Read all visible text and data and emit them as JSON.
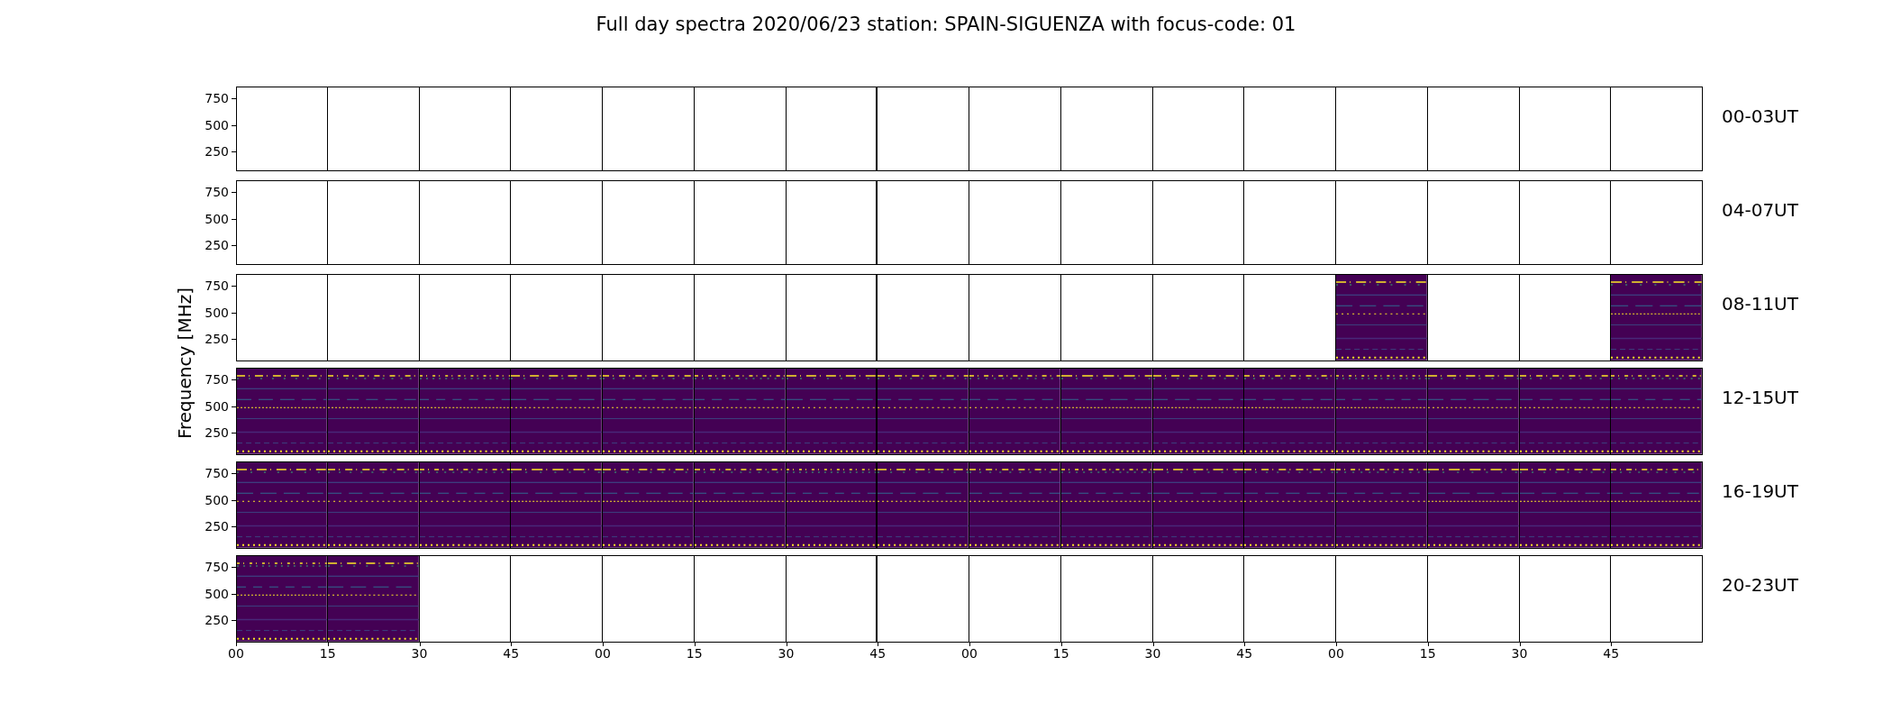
{
  "title": "Full day spectra 2020/06/23 station: SPAIN-SIGUENZA with focus-code: 01",
  "ylabel": "Frequency [MHz]",
  "rows": [
    {
      "label": "00-03UT",
      "yticks": [
        "750",
        "500",
        "250"
      ],
      "cells": [
        {
          "filled": false
        },
        {
          "filled": false
        },
        {
          "filled": false
        },
        {
          "filled": false
        },
        {
          "filled": false
        },
        {
          "filled": false
        },
        {
          "filled": false
        },
        {
          "filled": false
        },
        {
          "filled": false
        },
        {
          "filled": false
        },
        {
          "filled": false
        },
        {
          "filled": false
        },
        {
          "filled": false
        },
        {
          "filled": false
        },
        {
          "filled": false
        },
        {
          "filled": false
        }
      ]
    },
    {
      "label": "04-07UT",
      "yticks": [
        "750",
        "500",
        "250"
      ],
      "cells": [
        {
          "filled": false
        },
        {
          "filled": false
        },
        {
          "filled": false
        },
        {
          "filled": false
        },
        {
          "filled": false
        },
        {
          "filled": false
        },
        {
          "filled": false
        },
        {
          "filled": false
        },
        {
          "filled": false
        },
        {
          "filled": false
        },
        {
          "filled": false
        },
        {
          "filled": false
        },
        {
          "filled": false
        },
        {
          "filled": false
        },
        {
          "filled": false
        },
        {
          "filled": false
        }
      ]
    },
    {
      "label": "08-11UT",
      "yticks": [
        "750",
        "500",
        "250"
      ],
      "cells": [
        {
          "filled": false
        },
        {
          "filled": false
        },
        {
          "filled": false
        },
        {
          "filled": false
        },
        {
          "filled": false
        },
        {
          "filled": false
        },
        {
          "filled": false
        },
        {
          "filled": false
        },
        {
          "filled": false
        },
        {
          "filled": false
        },
        {
          "filled": false
        },
        {
          "filled": false
        },
        {
          "filled": true
        },
        {
          "filled": false
        },
        {
          "filled": false
        },
        {
          "filled": true
        }
      ]
    },
    {
      "label": "12-15UT",
      "yticks": [
        "750",
        "500",
        "250"
      ],
      "cells": [
        {
          "filled": true
        },
        {
          "filled": true
        },
        {
          "filled": true
        },
        {
          "filled": true
        },
        {
          "filled": true
        },
        {
          "filled": true
        },
        {
          "filled": true
        },
        {
          "filled": true
        },
        {
          "filled": true
        },
        {
          "filled": true
        },
        {
          "filled": true
        },
        {
          "filled": true
        },
        {
          "filled": true
        },
        {
          "filled": true
        },
        {
          "filled": true
        },
        {
          "filled": true
        }
      ]
    },
    {
      "label": "16-19UT",
      "yticks": [
        "750",
        "500",
        "250"
      ],
      "cells": [
        {
          "filled": true
        },
        {
          "filled": true
        },
        {
          "filled": true
        },
        {
          "filled": true
        },
        {
          "filled": true
        },
        {
          "filled": true
        },
        {
          "filled": true
        },
        {
          "filled": true
        },
        {
          "filled": true
        },
        {
          "filled": true
        },
        {
          "filled": true
        },
        {
          "filled": true
        },
        {
          "filled": true
        },
        {
          "filled": true
        },
        {
          "filled": true
        },
        {
          "filled": true
        }
      ]
    },
    {
      "label": "20-23UT",
      "yticks": [
        "750",
        "500",
        "250"
      ],
      "cells": [
        {
          "filled": true
        },
        {
          "filled": true
        },
        {
          "filled": false
        },
        {
          "filled": false
        },
        {
          "filled": false
        },
        {
          "filled": false
        },
        {
          "filled": false
        },
        {
          "filled": false
        },
        {
          "filled": false
        },
        {
          "filled": false
        },
        {
          "filled": false
        },
        {
          "filled": false
        },
        {
          "filled": false
        },
        {
          "filled": false
        },
        {
          "filled": false
        },
        {
          "filled": false
        }
      ]
    }
  ],
  "xticks": [
    "00",
    "15",
    "30",
    "45",
    "00",
    "15",
    "30",
    "45",
    "00",
    "15",
    "30",
    "45",
    "00",
    "15",
    "30",
    "45"
  ]
}
